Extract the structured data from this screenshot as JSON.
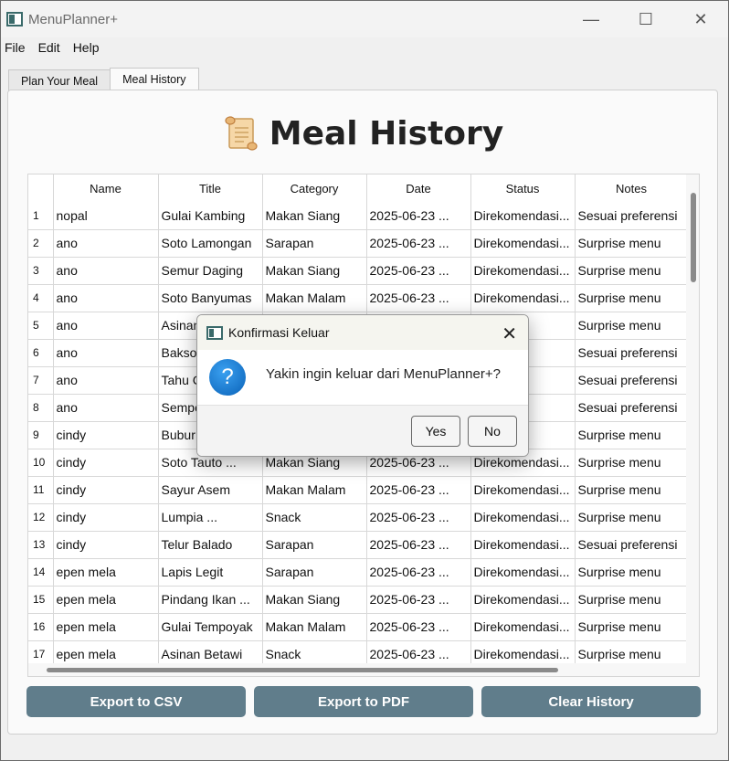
{
  "window": {
    "title": "MenuPlanner+",
    "minimize": "—",
    "maximize": "☐",
    "close": "✕"
  },
  "menu": [
    "File",
    "Edit",
    "Help"
  ],
  "tabs": [
    "Plan Your Meal",
    "Meal History"
  ],
  "page": {
    "heading": "Meal History",
    "heading_icon": "scroll-icon"
  },
  "table": {
    "columns": [
      "Name",
      "Title",
      "Category",
      "Date",
      "Status",
      "Notes"
    ],
    "rows": [
      [
        "1",
        "nopal",
        "Gulai Kambing",
        "Makan Siang",
        "2025-06-23 ...",
        "Direkomendasi...",
        "Sesuai preferensi"
      ],
      [
        "2",
        "ano",
        "Soto Lamongan",
        "Sarapan",
        "2025-06-23 ...",
        "Direkomendasi...",
        "Surprise menu"
      ],
      [
        "3",
        "ano",
        "Semur Daging",
        "Makan Siang",
        "2025-06-23 ...",
        "Direkomendasi...",
        "Surprise menu"
      ],
      [
        "4",
        "ano",
        "Soto Banyumas",
        "Makan Malam",
        "2025-06-23 ...",
        "Direkomendasi...",
        "Surprise menu"
      ],
      [
        "5",
        "ano",
        "Asinan",
        "",
        "",
        "ndasi...",
        "Surprise menu"
      ],
      [
        "6",
        "ano",
        "Bakso",
        "",
        "",
        "ndasi...",
        "Sesuai preferensi"
      ],
      [
        "7",
        "ano",
        "Tahu C",
        "",
        "",
        "ndasi...",
        "Sesuai preferensi"
      ],
      [
        "8",
        "ano",
        "Sempo",
        "",
        "",
        "ndasi...",
        "Sesuai preferensi"
      ],
      [
        "9",
        "cindy",
        "Bubur",
        "",
        "",
        "ndasi...",
        "Surprise menu"
      ],
      [
        "10",
        "cindy",
        "Soto Tauto ...",
        "Makan Siang",
        "2025-06-23 ...",
        "Direkomendasi...",
        "Surprise menu"
      ],
      [
        "11",
        "cindy",
        "Sayur Asem",
        "Makan Malam",
        "2025-06-23 ...",
        "Direkomendasi...",
        "Surprise menu"
      ],
      [
        "12",
        "cindy",
        "Lumpia ...",
        "Snack",
        "2025-06-23 ...",
        "Direkomendasi...",
        "Surprise menu"
      ],
      [
        "13",
        "cindy",
        "Telur Balado",
        "Sarapan",
        "2025-06-23 ...",
        "Direkomendasi...",
        "Sesuai preferensi"
      ],
      [
        "14",
        "epen mela",
        "Lapis Legit",
        "Sarapan",
        "2025-06-23 ...",
        "Direkomendasi...",
        "Surprise menu"
      ],
      [
        "15",
        "epen mela",
        "Pindang Ikan ...",
        "Makan Siang",
        "2025-06-23 ...",
        "Direkomendasi...",
        "Surprise menu"
      ],
      [
        "16",
        "epen mela",
        "Gulai Tempoyak",
        "Makan Malam",
        "2025-06-23 ...",
        "Direkomendasi...",
        "Surprise menu"
      ],
      [
        "17",
        "epen mela",
        "Asinan Betawi",
        "Snack",
        "2025-06-23 ...",
        "Direkomendasi...",
        "Surprise menu"
      ]
    ]
  },
  "buttons": {
    "export_csv": "Export to CSV",
    "export_pdf": "Export to PDF",
    "clear_history": "Clear History"
  },
  "dialog": {
    "title": "Konfirmasi Keluar",
    "message": "Yakin ingin keluar dari MenuPlanner+?",
    "yes": "Yes",
    "no": "No",
    "close": "✕",
    "icon": "question-icon"
  },
  "colors": {
    "accent_button": "#607d8b",
    "question_icon": "#1a7fd6"
  }
}
